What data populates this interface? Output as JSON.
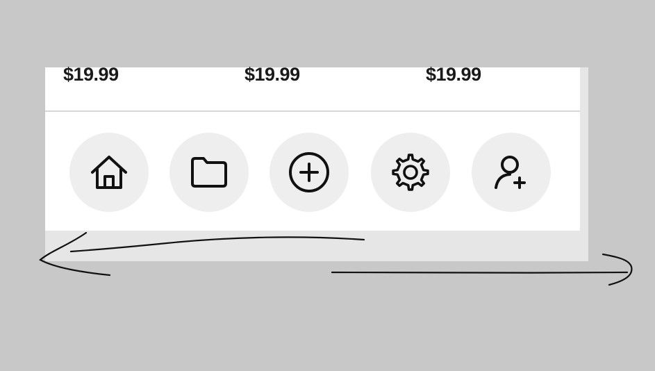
{
  "products": {
    "prices": [
      "$19.99",
      "$19.99",
      "$19.99"
    ]
  },
  "bottom_nav": {
    "items": [
      {
        "icon": "home-icon"
      },
      {
        "icon": "folder-icon"
      },
      {
        "icon": "plus-circle-icon"
      },
      {
        "icon": "gear-icon"
      },
      {
        "icon": "add-user-icon"
      }
    ]
  },
  "annotations": {
    "left_arrow_icon": "left-swipe-arrow-icon",
    "right_arrow_icon": "right-swipe-arrow-icon"
  },
  "colors": {
    "background": "#c8c8c8",
    "panel": "#ffffff",
    "nav_button": "#eeeeee",
    "icon_stroke": "#111111"
  }
}
